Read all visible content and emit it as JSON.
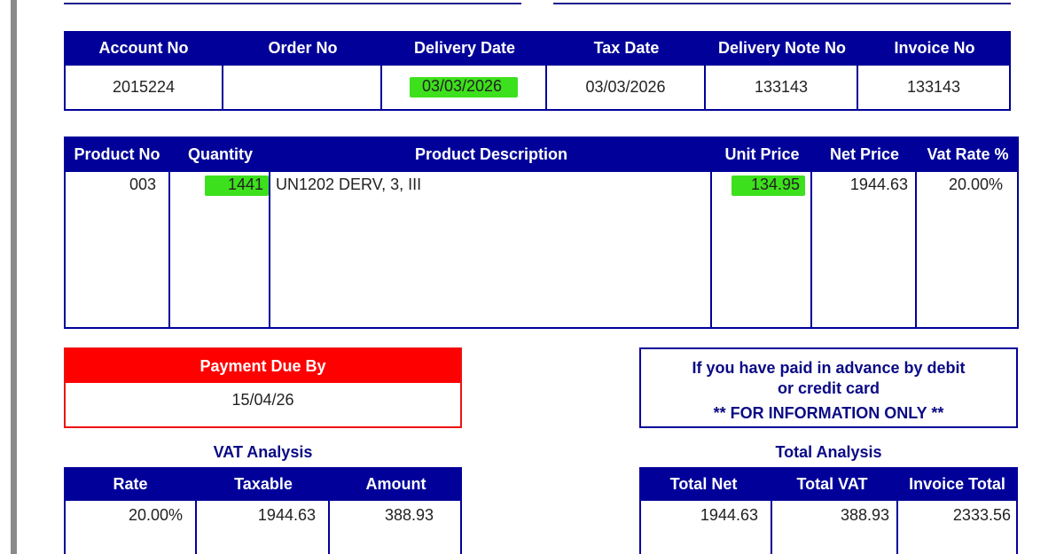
{
  "header_table": {
    "columns": [
      "Account No",
      "Order No",
      "Delivery Date",
      "Tax Date",
      "Delivery Note No",
      "Invoice No"
    ],
    "values": {
      "account_no": "2015224",
      "order_no": "",
      "delivery_date": "03/03/2026",
      "tax_date": "03/03/2026",
      "delivery_note_no": "133143",
      "invoice_no": "133143"
    }
  },
  "product_table": {
    "columns": [
      "Product No",
      "Quantity",
      "Product Description",
      "Unit Price",
      "Net Price",
      "Vat Rate %"
    ],
    "rows": [
      {
        "product_no": "003",
        "quantity": "1441",
        "description": "UN1202 DERV, 3, III",
        "unit_price": "134.95",
        "net_price": "1944.63",
        "vat_rate": "20.00%"
      }
    ]
  },
  "payment": {
    "title": "Payment Due By",
    "date": "15/04/26"
  },
  "info_box": {
    "line1": "If you have paid in advance by debit",
    "line2": "or credit card",
    "line3": "** FOR INFORMATION ONLY **"
  },
  "vat_analysis": {
    "title": "VAT Analysis",
    "columns": [
      "Rate",
      "Taxable",
      "Amount"
    ],
    "row": {
      "rate": "20.00%",
      "taxable": "1944.63",
      "amount": "388.93"
    }
  },
  "total_analysis": {
    "title": "Total Analysis",
    "columns": [
      "Total Net",
      "Total VAT",
      "Invoice Total"
    ],
    "row": {
      "total_net": "1944.63",
      "total_vat": "388.93",
      "invoice_total": "2333.56"
    }
  },
  "colors": {
    "navy": "#010199",
    "red": "#ff0000",
    "highlight": "#3de01c"
  }
}
